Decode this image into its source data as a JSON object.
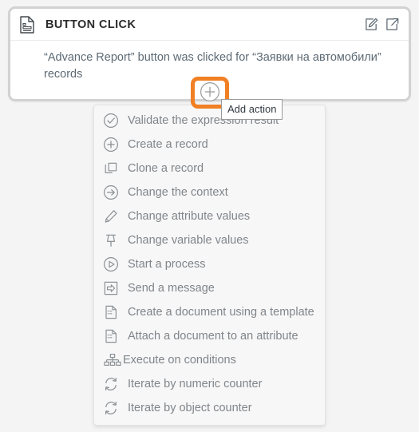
{
  "card": {
    "icon": "document-icon",
    "title": "BUTTON CLICK",
    "body_text": "“Advance Report” button was clicked for “Заявки на автомобили” records",
    "actions": [
      {
        "name": "edit-icon",
        "label": "Edit"
      },
      {
        "name": "open-external-icon",
        "label": "Open"
      }
    ]
  },
  "add_action": {
    "button_icon": "plus-circle-icon",
    "tooltip": "Add action",
    "highlight_color": "#f18024"
  },
  "menu": {
    "items": [
      {
        "icon": "check-circle-icon",
        "label": "Validate the expression result"
      },
      {
        "icon": "plus-circle-icon",
        "label": "Create a record"
      },
      {
        "icon": "clone-icon",
        "label": "Clone a record"
      },
      {
        "icon": "arrow-right-circle-icon",
        "label": "Change the context"
      },
      {
        "icon": "pencil-icon",
        "label": "Change attribute values"
      },
      {
        "icon": "pin-icon",
        "label": "Change variable values"
      },
      {
        "icon": "play-circle-icon",
        "label": "Start a process"
      },
      {
        "icon": "send-message-icon",
        "label": "Send a message"
      },
      {
        "icon": "document-icon",
        "label": "Create a document using a template"
      },
      {
        "icon": "document-icon",
        "label": "Attach a document to an attribute"
      },
      {
        "icon": "sitemap-icon",
        "label": "Execute on conditions"
      },
      {
        "icon": "loop-icon",
        "label": "Iterate by numeric counter"
      },
      {
        "icon": "loop-icon",
        "label": "Iterate by object counter"
      }
    ]
  },
  "colors": {
    "background": "#f4f4f4",
    "card_border": "#d2d2d2",
    "title_text": "#2b2b2b",
    "body_text": "#5d6a74",
    "menu_text": "#80858a",
    "accent_orange": "#f18024"
  }
}
